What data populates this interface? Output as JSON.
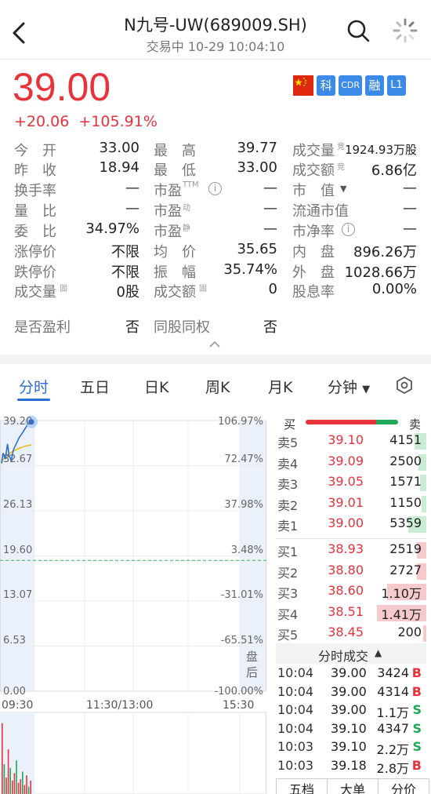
{
  "header": {
    "title": "N九号-UW(689009.SH)",
    "subtitle": "交易中  10-29 10:04:10"
  },
  "quote": {
    "price": "39.00",
    "change": "+20.06",
    "change_pct": "+105.91%"
  },
  "badges": [
    "科",
    "CDR",
    "融",
    "L1"
  ],
  "stats": [
    [
      "今　开",
      "33.00",
      "最　高",
      "39.77",
      "成交量",
      "1924.93万股"
    ],
    [
      "昨　收",
      "18.94",
      "最　低",
      "33.00",
      "成交额",
      "6.86亿"
    ],
    [
      "换手率",
      "—",
      "市盈",
      "—",
      "市　值",
      "—"
    ],
    [
      "量　比",
      "—",
      "市盈",
      "—",
      "流通市值",
      "—"
    ],
    [
      "委　比",
      "34.97%",
      "市盈",
      "—",
      "市净率",
      "—"
    ],
    [
      "涨停价",
      "不限",
      "均　价",
      "35.65",
      "内　盘",
      "896.26万"
    ],
    [
      "跌停价",
      "不限",
      "振　幅",
      "35.74%",
      "外　盘",
      "1028.66万"
    ],
    [
      "成交量",
      "0股",
      "成交额",
      "0",
      "股息率",
      "0.00%"
    ]
  ],
  "stat_sups": {
    "ttm": "TTM",
    "dong": "动",
    "jing": "静",
    "jing2": "竞",
    "gu": "固"
  },
  "profit": {
    "l1": "是否盈利",
    "v1": "否",
    "l2": "同股同权",
    "v2": "否"
  },
  "tabs": [
    "分时",
    "五日",
    "日K",
    "周K",
    "月K",
    "分钟"
  ],
  "chart_data": {
    "type": "line",
    "title": "",
    "y_left_ticks": [
      "39.20",
      "32.67",
      "26.13",
      "19.60",
      "13.07",
      "6.53",
      "0.00"
    ],
    "y_right_ticks": [
      "106.97%",
      "72.47%",
      "37.98%",
      "3.48%",
      "-31.01%",
      "-65.51%",
      "-100.00%"
    ],
    "x_ticks": [
      "09:30",
      "11:30/13:00",
      "15:30"
    ],
    "ylim": [
      0,
      39.2
    ],
    "prev_close": 18.94,
    "price_x": [
      0,
      0.2,
      0.5,
      0.8,
      1.0,
      1.3,
      1.6,
      2.0,
      2.4,
      2.8,
      3.2,
      3.6,
      4.0
    ],
    "price_y": [
      33.0,
      34.5,
      33.6,
      35.8,
      34.2,
      33.4,
      35.0,
      35.9,
      36.8,
      37.4,
      38.1,
      38.8,
      39.0
    ],
    "avg_y": [
      33.0,
      33.6,
      33.9,
      34.2,
      34.4,
      34.6,
      34.8,
      35.0,
      35.2,
      35.35,
      35.5,
      35.6,
      35.65
    ],
    "panel_label": [
      "盘",
      "后"
    ]
  },
  "orderbook": {
    "header_buy": "买",
    "header_sell": "卖",
    "sells": [
      [
        "卖5",
        "39.10",
        "4151"
      ],
      [
        "卖4",
        "39.09",
        "2500"
      ],
      [
        "卖3",
        "39.05",
        "1571"
      ],
      [
        "卖2",
        "39.01",
        "1150"
      ],
      [
        "卖1",
        "39.00",
        "5359"
      ]
    ],
    "sell_fill": [
      0.08,
      0.05,
      0.04,
      0.03,
      0.12
    ],
    "buys": [
      [
        "买1",
        "38.93",
        "2519"
      ],
      [
        "买2",
        "38.80",
        "2727"
      ],
      [
        "买3",
        "38.60",
        "1.10万"
      ],
      [
        "买4",
        "38.51",
        "1.41万"
      ],
      [
        "买5",
        "38.45",
        "200"
      ]
    ],
    "buy_fill": [
      0.06,
      0.06,
      0.26,
      0.33,
      0.02
    ],
    "trades_title": "分时成交",
    "trades": [
      [
        "10:04",
        "39.00",
        "3424",
        "B"
      ],
      [
        "10:04",
        "39.00",
        "4314",
        "B"
      ],
      [
        "10:04",
        "39.00",
        "1.1万",
        "S"
      ],
      [
        "10:04",
        "39.10",
        "4347",
        "S"
      ],
      [
        "10:03",
        "39.10",
        "2.2万",
        "S"
      ],
      [
        "10:03",
        "39.18",
        "2.8万",
        "B"
      ]
    ]
  },
  "bottom_tabs": [
    "五档",
    "大单",
    "分价"
  ],
  "colors": {
    "red": "#e8323c",
    "green": "#1faa5a",
    "blue": "#2a6ed6"
  }
}
